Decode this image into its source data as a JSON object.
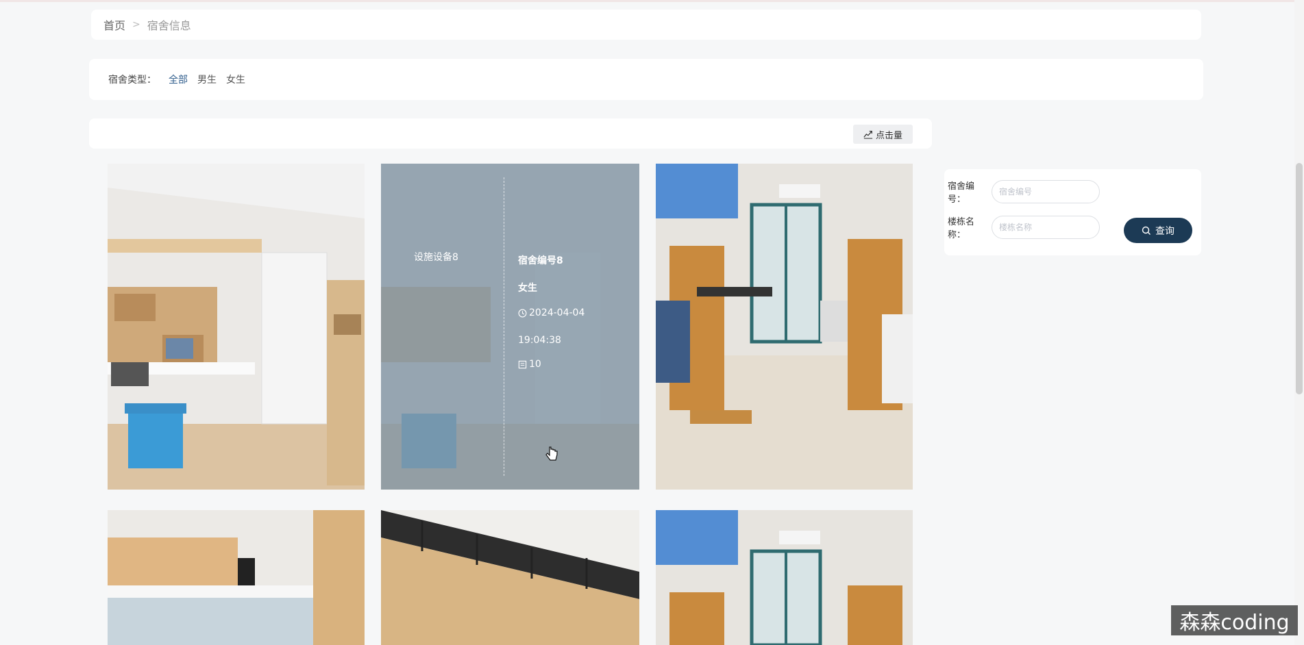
{
  "breadcrumb": {
    "home": "首页",
    "separator": ">",
    "current": "宿舍信息"
  },
  "filter": {
    "label": "宿舍类型：",
    "options": [
      "全部",
      "男生",
      "女生"
    ],
    "active_index": 0
  },
  "sort": {
    "label": "点击量",
    "icon": "trend-icon"
  },
  "cards": [
    {
      "scene": "modern-dorm-desk"
    },
    {
      "scene": "modern-dorm-desk",
      "hover": true,
      "facility": "设施设备8",
      "room_no": "宿舍编号8",
      "gender": "女生",
      "date": "2024-04-04",
      "time": "19:04:38",
      "clicks": "10"
    },
    {
      "scene": "students-in-dorm"
    },
    {
      "scene": "bunk-close-up"
    },
    {
      "scene": "metal-bunk-bed"
    },
    {
      "scene": "students-in-dorm"
    }
  ],
  "search": {
    "room_label": "宿舍编号：",
    "room_placeholder": "宿舍编号",
    "building_label": "楼栋名称：",
    "building_placeholder": "楼栋名称",
    "query_label": "查询"
  },
  "watermark": "森森coding",
  "colors": {
    "accent": "#1c3a55",
    "active_link": "#2f5d8c",
    "overlay": "#8296a5"
  }
}
